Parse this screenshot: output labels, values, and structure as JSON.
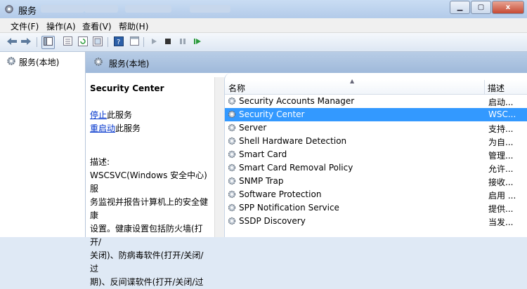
{
  "window": {
    "title": "服务",
    "close_glyph": "x"
  },
  "menu": [
    {
      "label": "文件(F)"
    },
    {
      "label": "操作(A)"
    },
    {
      "label": "查看(V)"
    },
    {
      "label": "帮助(H)"
    }
  ],
  "tree": {
    "root_label": "服务(本地)"
  },
  "panel": {
    "header": "服务(本地)"
  },
  "detail": {
    "service_title": "Security Center",
    "stop_link": "停止",
    "stop_suffix": "此服务",
    "restart_link": "重启动",
    "restart_suffix": "此服务",
    "desc_label": "描述:",
    "desc_lines": [
      "WSCSVC(Windows 安全中心)服",
      "务监视并报告计算机上的安全健康",
      "设置。健康设置包括防火墙(打开/",
      "关闭)、防病毒软件(打开/关闭/过",
      "期)、反间谍软件(打开/关闭/过"
    ]
  },
  "list": {
    "columns": {
      "name": "名称",
      "desc": "描述"
    },
    "rows": [
      {
        "name": "Security Accounts Manager",
        "desc": "启动..."
      },
      {
        "name": "Security Center",
        "desc": "WSC..."
      },
      {
        "name": "Server",
        "desc": "支持..."
      },
      {
        "name": "Shell Hardware Detection",
        "desc": "为自..."
      },
      {
        "name": "Smart Card",
        "desc": "管理..."
      },
      {
        "name": "Smart Card Removal Policy",
        "desc": "允许..."
      },
      {
        "name": "SNMP Trap",
        "desc": "接收..."
      },
      {
        "name": "Software Protection",
        "desc": "启用 ..."
      },
      {
        "name": "SPP Notification Service",
        "desc": "提供..."
      },
      {
        "name": "SSDP Discovery",
        "desc": "当发..."
      }
    ],
    "selected_index": 1
  },
  "colors": {
    "selection": "#3399ff",
    "link": "#0033cc",
    "header": "#9fb9da"
  }
}
